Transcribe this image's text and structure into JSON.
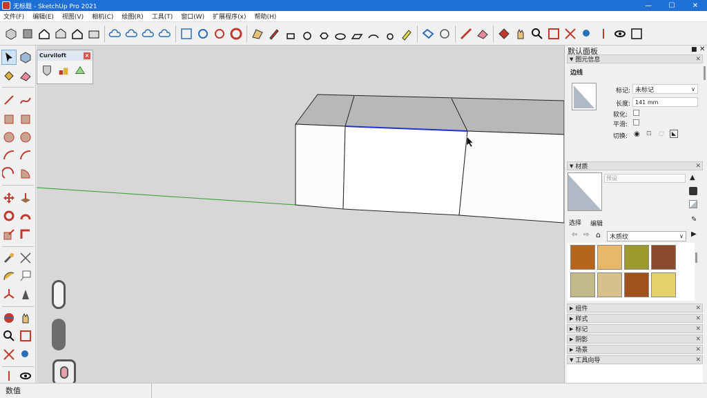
{
  "window": {
    "title": "无标题 - SketchUp Pro 2021",
    "minimize": "—",
    "maximize": "☐",
    "close": "✕"
  },
  "menu": [
    "文件(F)",
    "编辑(E)",
    "视图(V)",
    "相机(C)",
    "绘图(R)",
    "工具(T)",
    "窗口(W)",
    "扩展程序(x)",
    "帮助(H)"
  ],
  "curviloft": {
    "title": "Curviloft",
    "close": "×"
  },
  "panel": {
    "title": "默认面板",
    "entity_info": {
      "header": "图元信息",
      "type": "边线",
      "tag_label": "标记:",
      "tag_value": "未标记",
      "length_label": "长度:",
      "length_value": "141 mm",
      "soften_label": "软化:",
      "smooth_label": "平滑:",
      "toggle_label": "切换:"
    },
    "materials": {
      "header": "材质",
      "name_placeholder": "预设",
      "tab_select": "选择",
      "tab_edit": "编辑",
      "library": "木质纹",
      "swatches": [
        "#b5651d",
        "#e8b86a",
        "#9c9a2e",
        "#8b4a2b",
        "#c2b98a",
        "#d8c08a",
        "#a0521e",
        "#e3d26a"
      ]
    },
    "collapsed": [
      "组件",
      "样式",
      "标记",
      "阴影",
      "场景",
      "工具向导"
    ]
  },
  "status": {
    "measurements_label": "数值"
  }
}
